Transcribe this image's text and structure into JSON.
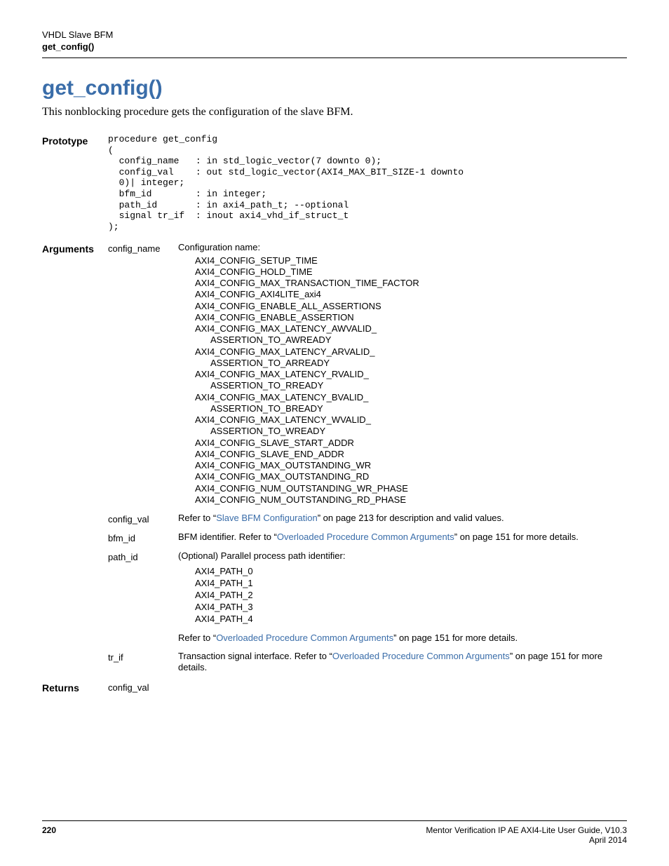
{
  "header": {
    "sup": "VHDL Slave BFM",
    "sub": "get_config()"
  },
  "title": "get_config()",
  "intro": "This nonblocking procedure gets the configuration of the slave BFM.",
  "prototype": {
    "label": "Prototype",
    "code": "procedure get_config\n(\n  config_name   : in std_logic_vector(7 downto 0);\n  config_val    : out std_logic_vector(AXI4_MAX_BIT_SIZE-1 downto\n  0)| integer;\n  bfm_id        : in integer;\n  path_id       : in axi4_path_t; --optional\n  signal tr_if  : inout axi4_vhd_if_struct_t\n);"
  },
  "arguments": {
    "label": "Arguments",
    "config_name": {
      "name": "config_name",
      "lead": "Configuration name:",
      "items": [
        "AXI4_CONFIG_SETUP_TIME",
        "AXI4_CONFIG_HOLD_TIME",
        "AXI4_CONFIG_MAX_TRANSACTION_TIME_FACTOR",
        "AXI4_CONFIG_AXI4LITE_axi4",
        "AXI4_CONFIG_ENABLE_ALL_ASSERTIONS",
        "AXI4_CONFIG_ENABLE_ASSERTION",
        "AXI4_CONFIG_MAX_LATENCY_AWVALID_",
        "  ASSERTION_TO_AWREADY",
        "AXI4_CONFIG_MAX_LATENCY_ARVALID_",
        "  ASSERTION_TO_ARREADY",
        "AXI4_CONFIG_MAX_LATENCY_RVALID_",
        "  ASSERTION_TO_RREADY",
        "AXI4_CONFIG_MAX_LATENCY_BVALID_",
        "  ASSERTION_TO_BREADY",
        "AXI4_CONFIG_MAX_LATENCY_WVALID_",
        "  ASSERTION_TO_WREADY",
        "AXI4_CONFIG_SLAVE_START_ADDR",
        "AXI4_CONFIG_SLAVE_END_ADDR",
        "AXI4_CONFIG_MAX_OUTSTANDING_WR",
        "AXI4_CONFIG_MAX_OUTSTANDING_RD",
        "AXI4_CONFIG_NUM_OUTSTANDING_WR_PHASE",
        "AXI4_CONFIG_NUM_OUTSTANDING_RD_PHASE"
      ]
    },
    "config_val": {
      "name": "config_val",
      "pre": "Refer to “",
      "link": "Slave BFM Configuration",
      "post": "” on page 213 for description and valid values."
    },
    "bfm_id": {
      "name": "bfm_id",
      "pre": "BFM identifier. Refer to “",
      "link": "Overloaded Procedure Common Arguments",
      "post": "” on page 151 for more details."
    },
    "path_id": {
      "name": "path_id",
      "lead": "(Optional) Parallel process path identifier:",
      "items": [
        "AXI4_PATH_0",
        "AXI4_PATH_1",
        "AXI4_PATH_2",
        "AXI4_PATH_3",
        "AXI4_PATH_4"
      ],
      "tail_pre": "Refer to “",
      "tail_link": "Overloaded Procedure Common Arguments",
      "tail_post": "” on page 151 for more details."
    },
    "tr_if": {
      "name": "tr_if",
      "pre": "Transaction signal interface. Refer to “",
      "link": "Overloaded Procedure Common Arguments",
      "post": "” on page 151 for more details."
    }
  },
  "returns": {
    "label": "Returns",
    "value": "config_val"
  },
  "footer": {
    "pnum": "220",
    "guide": "Mentor Verification IP AE AXI4-Lite User Guide, V10.3",
    "date": "April 2014"
  }
}
